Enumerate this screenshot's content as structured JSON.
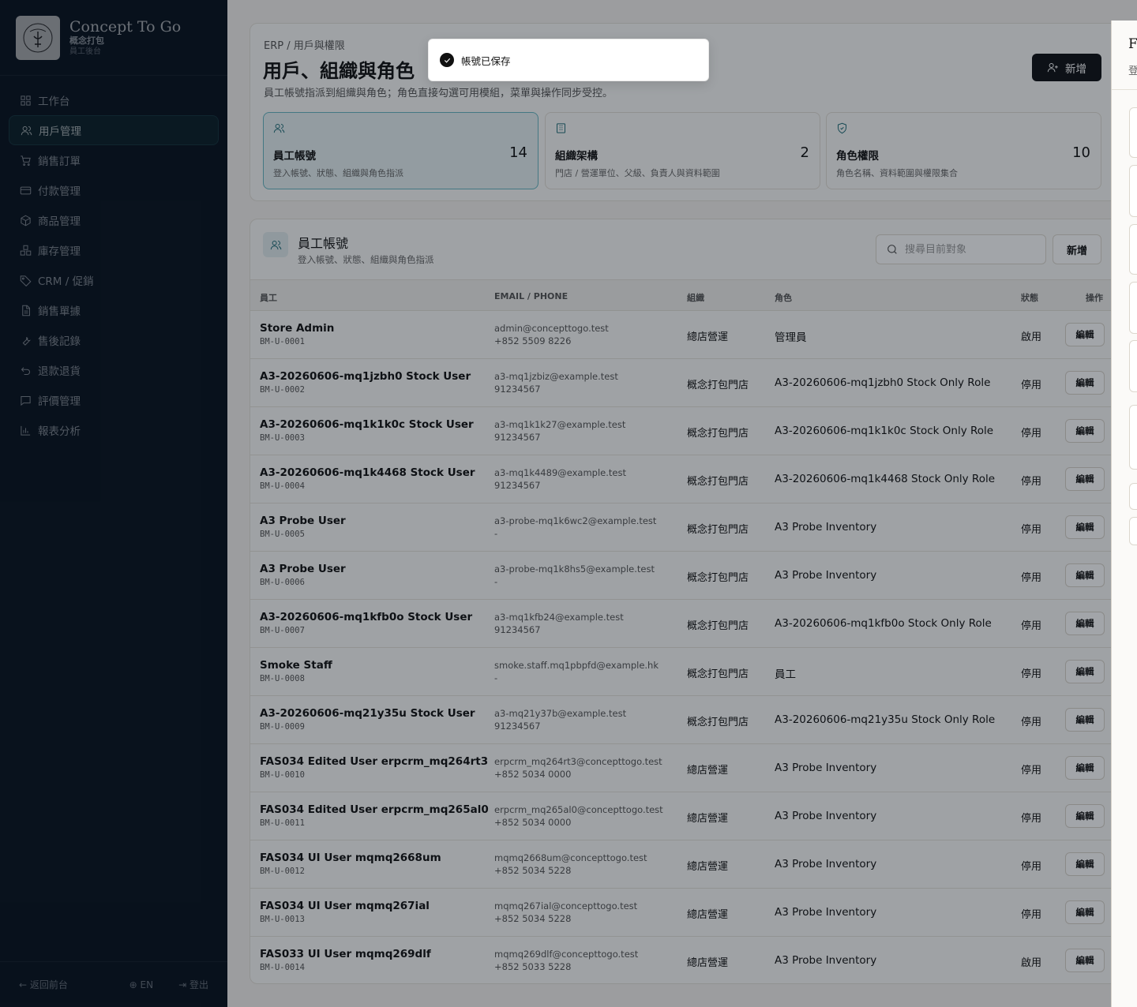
{
  "brand": {
    "title": "Concept To Go",
    "subtitle": "概念打包",
    "subtitle2": "員工後台"
  },
  "nav": [
    {
      "label": "工作台",
      "icon": "dashboard-icon",
      "active": false
    },
    {
      "label": "用戶管理",
      "icon": "users-icon",
      "active": true
    },
    {
      "label": "銷售訂單",
      "icon": "cart-icon",
      "active": false
    },
    {
      "label": "付款管理",
      "icon": "card-icon",
      "active": false
    },
    {
      "label": "商品管理",
      "icon": "box-icon",
      "active": false
    },
    {
      "label": "庫存管理",
      "icon": "boxes-icon",
      "active": false
    },
    {
      "label": "CRM / 促銷",
      "icon": "tag-icon",
      "active": false
    },
    {
      "label": "銷售單據",
      "icon": "file-icon",
      "active": false
    },
    {
      "label": "售後記錄",
      "icon": "wrench-icon",
      "active": false
    },
    {
      "label": "退款退貨",
      "icon": "undo-icon",
      "active": false
    },
    {
      "label": "評價管理",
      "icon": "message-icon",
      "active": false
    },
    {
      "label": "報表分析",
      "icon": "bar-chart-icon",
      "active": false
    }
  ],
  "footer": {
    "back": "返回前台",
    "lang": "EN",
    "logout": "登出"
  },
  "header": {
    "breadcrumb": "ERP / 用戶與權限",
    "title": "用戶、組織與角色",
    "description": "員工帳號指派到組織與角色；角色直接勾選可用模組，菜單與操作同步受控。",
    "add_label": "新增"
  },
  "stats": [
    {
      "name": "員工帳號",
      "desc": "登入帳號、狀態、組織與角色指派",
      "count": "14",
      "active": true
    },
    {
      "name": "組織架構",
      "desc": "門店 / 營運單位、父級、負責人與資料範圍",
      "count": "2",
      "active": false
    },
    {
      "name": "角色權限",
      "desc": "角色名稱、資料範圍與權限集合",
      "count": "10",
      "active": false
    }
  ],
  "table": {
    "title": "員工帳號",
    "description": "登入帳號、狀態、組織與角色指派",
    "search_placeholder": "搜尋目前對象",
    "add_label": "新增",
    "columns": [
      "員工",
      "EMAIL / PHONE",
      "組織",
      "角色",
      "狀態",
      "操作"
    ],
    "edit_label": "編輯",
    "rows": [
      {
        "name": "Store Admin",
        "code": "BM-U-0001",
        "email": "admin@concepttogo.test",
        "phone": "+852 5509 8226",
        "org": "總店營運",
        "role": "管理員",
        "status": "啟用"
      },
      {
        "name": "A3-20260606-mq1jzbh0 Stock User",
        "code": "BM-U-0002",
        "email": "a3-mq1jzbiz@example.test",
        "phone": "91234567",
        "org": "概念打包門店",
        "role": "A3-20260606-mq1jzbh0 Stock Only Role",
        "status": "停用"
      },
      {
        "name": "A3-20260606-mq1k1k0c Stock User",
        "code": "BM-U-0003",
        "email": "a3-mq1k1k27@example.test",
        "phone": "91234567",
        "org": "概念打包門店",
        "role": "A3-20260606-mq1k1k0c Stock Only Role",
        "status": "停用"
      },
      {
        "name": "A3-20260606-mq1k4468 Stock User",
        "code": "BM-U-0004",
        "email": "a3-mq1k4489@example.test",
        "phone": "91234567",
        "org": "概念打包門店",
        "role": "A3-20260606-mq1k4468 Stock Only Role",
        "status": "停用"
      },
      {
        "name": "A3 Probe User",
        "code": "BM-U-0005",
        "email": "a3-probe-mq1k6wc2@example.test",
        "phone": "-",
        "org": "概念打包門店",
        "role": "A3 Probe Inventory",
        "status": "停用"
      },
      {
        "name": "A3 Probe User",
        "code": "BM-U-0006",
        "email": "a3-probe-mq1k8hs5@example.test",
        "phone": "-",
        "org": "概念打包門店",
        "role": "A3 Probe Inventory",
        "status": "停用"
      },
      {
        "name": "A3-20260606-mq1kfb0o Stock User",
        "code": "BM-U-0007",
        "email": "a3-mq1kfb24@example.test",
        "phone": "91234567",
        "org": "概念打包門店",
        "role": "A3-20260606-mq1kfb0o Stock Only Role",
        "status": "停用"
      },
      {
        "name": "Smoke Staff",
        "code": "BM-U-0008",
        "email": "smoke.staff.mq1pbpfd@example.hk",
        "phone": "-",
        "org": "概念打包門店",
        "role": "員工",
        "status": "停用"
      },
      {
        "name": "A3-20260606-mq21y35u Stock User",
        "code": "BM-U-0009",
        "email": "a3-mq21y37b@example.test",
        "phone": "91234567",
        "org": "概念打包門店",
        "role": "A3-20260606-mq21y35u Stock Only Role",
        "status": "停用"
      },
      {
        "name": "FAS034 Edited User erpcrm_mq264rt3",
        "code": "BM-U-0010",
        "email": "erpcrm_mq264rt3@concepttogo.test",
        "phone": "+852 5034 0000",
        "org": "總店營運",
        "role": "A3 Probe Inventory",
        "status": "停用"
      },
      {
        "name": "FAS034 Edited User erpcrm_mq265al0",
        "code": "BM-U-0011",
        "email": "erpcrm_mq265al0@concepttogo.test",
        "phone": "+852 5034 0000",
        "org": "總店營運",
        "role": "A3 Probe Inventory",
        "status": "停用"
      },
      {
        "name": "FAS034 UI User mqmq2668um",
        "code": "BM-U-0012",
        "email": "mqmq2668um@concepttogo.test",
        "phone": "+852 5034 5228",
        "org": "總店營運",
        "role": "A3 Probe Inventory",
        "status": "停用"
      },
      {
        "name": "FAS034 UI User mqmq267ial",
        "code": "BM-U-0013",
        "email": "mqmq267ial@concepttogo.test",
        "phone": "+852 5034 5228",
        "org": "總店營運",
        "role": "A3 Probe Inventory",
        "status": "停用"
      },
      {
        "name": "FAS033 UI User mqmq269dlf",
        "code": "BM-U-0014",
        "email": "mqmq269dlf@concepttogo.test",
        "phone": "+852 5033 5228",
        "org": "總店營運",
        "role": "A3 Probe Inventory",
        "status": "啟用"
      }
    ]
  },
  "toast": {
    "message": "帳號已保存",
    "icon": "check-circle-icon"
  },
  "drawer": {
    "title": "F",
    "subtitle": "登"
  }
}
